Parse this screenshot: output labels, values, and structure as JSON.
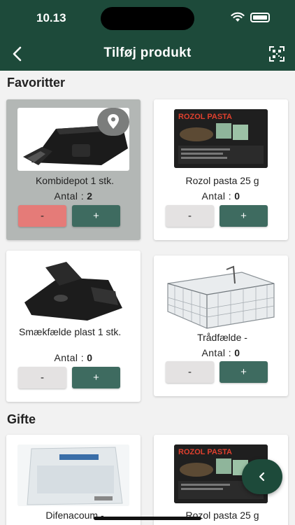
{
  "status_bar": {
    "time": "10.13"
  },
  "header": {
    "title": "Tilføj produkt"
  },
  "sections": [
    {
      "title": "Favoritter",
      "products": [
        {
          "name": "Kombidepot 1 stk.",
          "qty_label": "Antal :",
          "qty": "2",
          "minus": "-",
          "plus": "+",
          "selected": true
        },
        {
          "name": "Rozol pasta 25 g",
          "qty_label": "Antal :",
          "qty": "0",
          "minus": "-",
          "plus": "+",
          "image_text": "ROZOL PASTA"
        },
        {
          "name": "Smækfælde plast 1 stk.",
          "qty_label": "Antal :",
          "qty": "0",
          "minus": "-",
          "plus": "+"
        },
        {
          "name": "Trådfælde -",
          "qty_label": "Antal :",
          "qty": "0",
          "minus": "-",
          "plus": "+"
        }
      ]
    },
    {
      "title": "Gifte",
      "products": [
        {
          "name": "Difenacoum -"
        },
        {
          "name": "Rozol pasta 25 g",
          "image_text": "ROZOL PASTA"
        }
      ]
    }
  ],
  "colors": {
    "header": "#1d4a3a",
    "plus": "#3e6b60",
    "minus_active": "#e57b78"
  }
}
